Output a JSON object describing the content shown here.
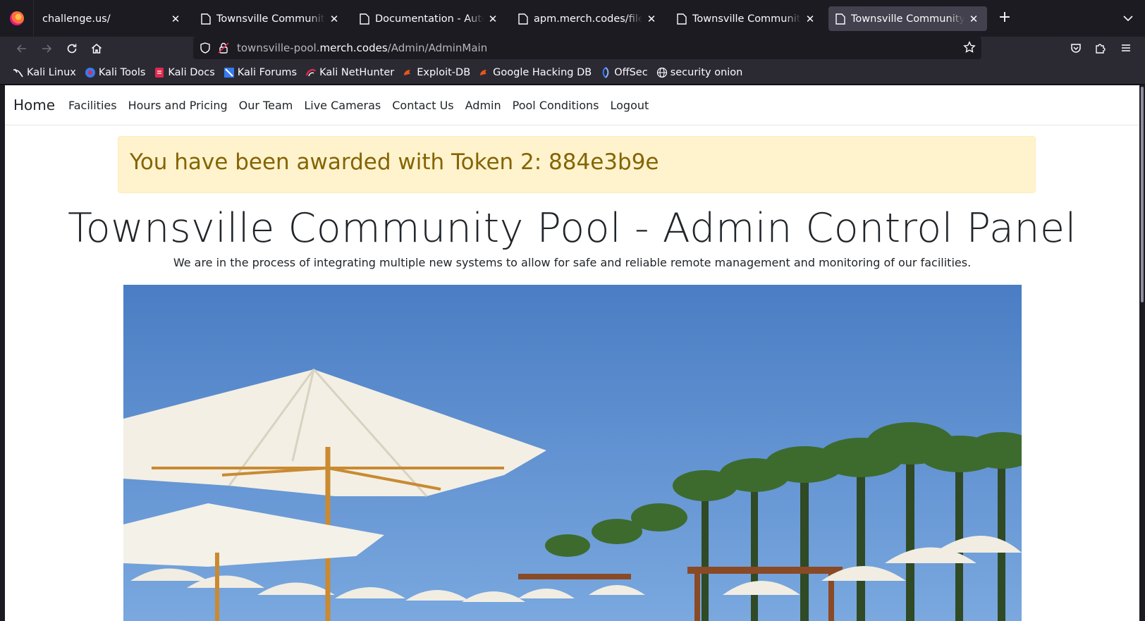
{
  "browser": {
    "tabs": [
      {
        "title": "challenge.us/",
        "active": false
      },
      {
        "title": "Townsville Community Pool",
        "active": false
      },
      {
        "title": "Documentation - Automation",
        "active": false
      },
      {
        "title": "apm.merch.codes/files/38",
        "active": false
      },
      {
        "title": "Townsville Community Pool",
        "active": false
      },
      {
        "title": "Townsville Community Pool",
        "active": true
      }
    ],
    "url": {
      "prefix": "townsville-pool.",
      "domain": "merch.codes",
      "path": "/Admin/AdminMain"
    },
    "bookmarks": [
      {
        "label": "Kali Linux",
        "icon": "kali-dragon-icon"
      },
      {
        "label": "Kali Tools",
        "icon": "kali-tools-icon"
      },
      {
        "label": "Kali Docs",
        "icon": "kali-docs-icon"
      },
      {
        "label": "Kali Forums",
        "icon": "kali-forums-icon"
      },
      {
        "label": "Kali NetHunter",
        "icon": "nethunter-icon"
      },
      {
        "label": "Exploit-DB",
        "icon": "exploit-db-icon"
      },
      {
        "label": "Google Hacking DB",
        "icon": "ghdb-icon"
      },
      {
        "label": "OffSec",
        "icon": "offsec-icon"
      },
      {
        "label": "security onion",
        "icon": "globe-icon"
      }
    ]
  },
  "site": {
    "brand": "Home",
    "nav": [
      "Facilities",
      "Hours and Pricing",
      "Our Team",
      "Live Cameras",
      "Contact Us",
      "Admin",
      "Pool Conditions",
      "Logout"
    ],
    "alert": "You have been awarded with Token 2: 884e3b9e",
    "title": "Townsville Community Pool - Admin Control Panel",
    "subtitle": "We are in the process of integrating multiple new systems to allow for safe and reliable remote management and monitoring of our facilities."
  },
  "colors": {
    "alert_bg": "#fff3cd",
    "alert_text": "#856404",
    "sky": "#4f80c4"
  }
}
